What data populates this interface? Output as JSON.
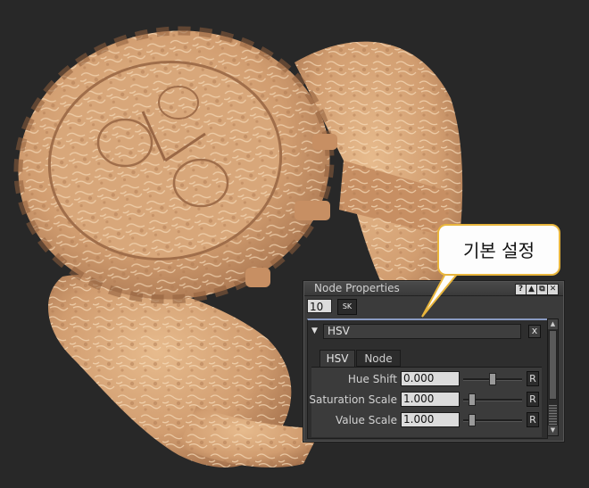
{
  "panel": {
    "title": "Node Properties",
    "titlebar_buttons": [
      "?",
      "▲",
      "⧉",
      "✕"
    ],
    "node_id": "10",
    "toolbar_button": "SK",
    "node_name": "HSV",
    "close_label": "x",
    "tabs": [
      {
        "label": "HSV",
        "active": true
      },
      {
        "label": "Node",
        "active": false
      }
    ],
    "params": [
      {
        "label": "Hue Shift",
        "value": "0.000",
        "slider_fraction": 0.5,
        "reset": "R"
      },
      {
        "label": "Saturation Scale",
        "value": "1.000",
        "slider_fraction": 0.1,
        "reset": "R"
      },
      {
        "label": "Value Scale",
        "value": "1.000",
        "slider_fraction": 0.1,
        "reset": "R"
      }
    ]
  },
  "callout": {
    "text": "기본 설정",
    "border_color": "#e8b53c"
  },
  "viewport": {
    "background_color": "#282828",
    "model_base_color": "#d9a777",
    "model_shadow_color": "#a8744d"
  }
}
